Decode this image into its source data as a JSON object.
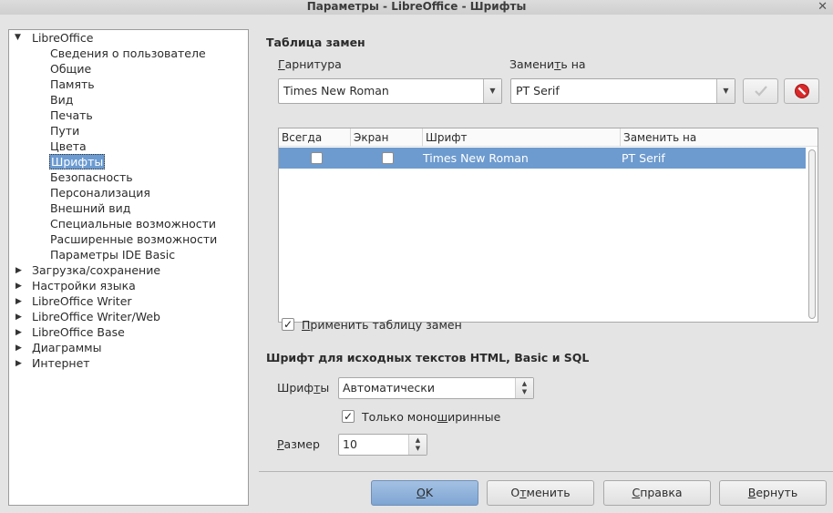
{
  "window": {
    "title": "Параметры - LibreOffice - Шрифты",
    "close": "✕"
  },
  "tree": {
    "root": "LibreOffice",
    "children": [
      "Сведения о пользователе",
      "Общие",
      "Память",
      "Вид",
      "Печать",
      "Пути",
      "Цвета",
      "Шрифты",
      "Безопасность",
      "Персонализация",
      "Внешний вид",
      "Специальные возможности",
      "Расширенные возможности",
      "Параметры IDE Basic"
    ],
    "selected": "Шрифты",
    "groups": [
      "Загрузка/сохранение",
      "Настройки языка",
      "LibreOffice Writer",
      "LibreOffice Writer/Web",
      "LibreOffice Base",
      "Диаграммы",
      "Интернет"
    ]
  },
  "replacement": {
    "heading": "Таблица замен",
    "font_label_u": "Г",
    "font_label_rest": "арнитура",
    "replace_label_pre": "Замени",
    "replace_label_u": "т",
    "replace_label_rest": "ь на",
    "font_value": "Times New Roman",
    "replace_value": "PT Serif",
    "columns": [
      "Всегда",
      "Экран",
      "Шрифт",
      "Заменить на"
    ],
    "rows": [
      {
        "always": false,
        "screen": false,
        "font": "Times New Roman",
        "replace": "PT Serif"
      }
    ],
    "apply_u": "П",
    "apply_rest": "рименить таблицу замен",
    "apply_checked": true
  },
  "source_fonts": {
    "heading": "Шрифт для исходных текстов HTML, Basic и SQL",
    "fonts_label_pre": "Шриф",
    "fonts_label_u": "т",
    "fonts_label_rest": "ы",
    "fonts_value": "Автоматически",
    "mono_pre": "Только моно",
    "mono_u": "ш",
    "mono_rest": "иринные",
    "mono_checked": true,
    "size_label_pre": "",
    "size_label_u": "Р",
    "size_label_rest": "азмер",
    "size_value": "10"
  },
  "buttons": {
    "ok_u": "О",
    "ok_rest": "K",
    "cancel_pre": "О",
    "cancel_u": "т",
    "cancel_rest": "менить",
    "help_u": "С",
    "help_rest": "правка",
    "reset_u": "В",
    "reset_rest": "ернуть"
  }
}
